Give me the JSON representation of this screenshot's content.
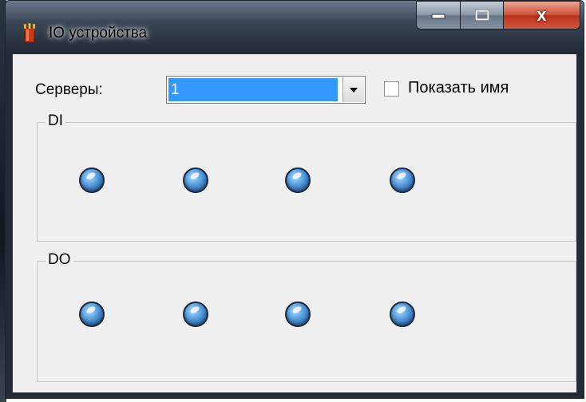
{
  "window": {
    "title": "IO устройства",
    "caption_buttons": {
      "minimize": "minimize",
      "maximize": "maximize",
      "close": "x"
    }
  },
  "toolbar": {
    "servers_label": "Серверы:",
    "servers_selected": "1",
    "show_name_label": "Показать имя",
    "show_name_checked": false
  },
  "groups": [
    {
      "legend": "DI",
      "indicator_count": 4,
      "indicator_color": "#4a90d9"
    },
    {
      "legend": "DO",
      "indicator_count": 4,
      "indicator_color": "#4a90d9"
    }
  ],
  "colors": {
    "selection": "#3399ff",
    "close_button": "#c7402a",
    "client_bg": "#f0f0f0"
  }
}
